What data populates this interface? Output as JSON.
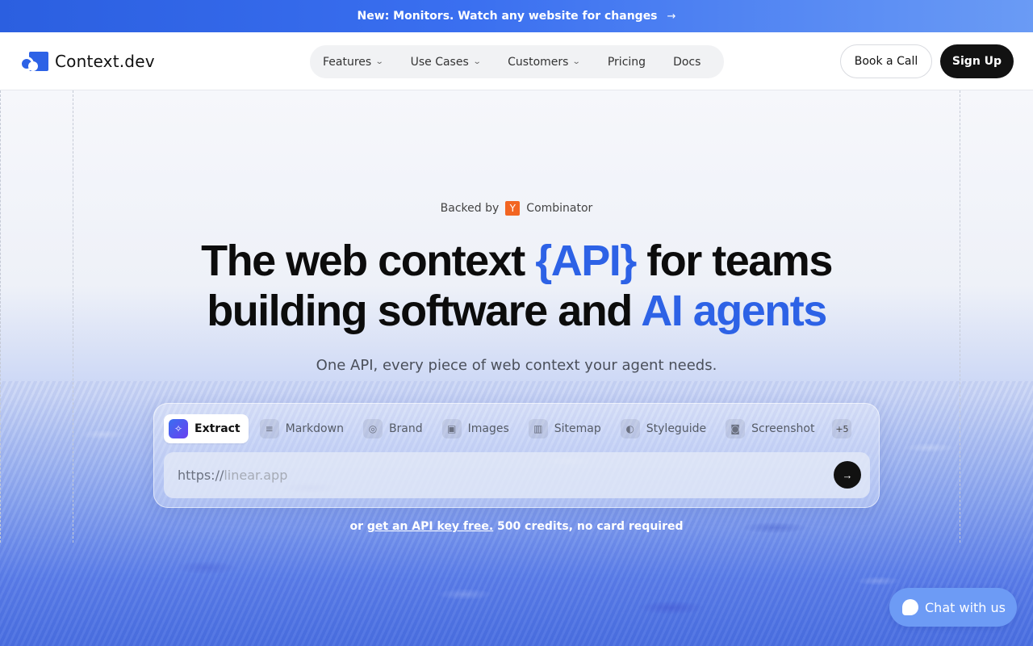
{
  "announcement": {
    "text": "New: Monitors. Watch any website for changes",
    "arrow": "→"
  },
  "header": {
    "logo_text": "Context.dev",
    "nav": [
      {
        "label": "Features",
        "has_menu": true
      },
      {
        "label": "Use Cases",
        "has_menu": true
      },
      {
        "label": "Customers",
        "has_menu": true
      },
      {
        "label": "Pricing",
        "has_menu": false
      },
      {
        "label": "Docs",
        "has_menu": false
      }
    ],
    "chevron": "⌄",
    "book_call": "Book a Call",
    "sign_up": "Sign Up"
  },
  "hero": {
    "backed_prefix": "Backed by",
    "yc_letter": "Y",
    "backed_suffix": "Combinator",
    "headline_part1": "The web context ",
    "headline_accent1": "{API}",
    "headline_part2": " for teams",
    "headline_part3": "building software and ",
    "headline_accent2": "AI agents",
    "subhead": "One API, every piece of web context your agent needs."
  },
  "tool": {
    "tabs": [
      {
        "label": "Extract",
        "icon": "sparkle-icon",
        "glyph": "✧",
        "active": true
      },
      {
        "label": "Markdown",
        "icon": "markdown-icon",
        "glyph": "≡",
        "active": false
      },
      {
        "label": "Brand",
        "icon": "brand-icon",
        "glyph": "◎",
        "active": false
      },
      {
        "label": "Images",
        "icon": "image-icon",
        "glyph": "▣",
        "active": false
      },
      {
        "label": "Sitemap",
        "icon": "map-icon",
        "glyph": "▥",
        "active": false
      },
      {
        "label": "Styleguide",
        "icon": "palette-icon",
        "glyph": "◐",
        "active": false
      },
      {
        "label": "Screenshot",
        "icon": "camera-icon",
        "glyph": "◙",
        "active": false
      }
    ],
    "more_label": "+5",
    "url_prefix": "https://",
    "url_placeholder": "linear.app",
    "go_glyph": "→"
  },
  "footnote": {
    "prefix": "or ",
    "link": "get an API key free.",
    "suffix": " 500 credits, no card required"
  },
  "chat": {
    "label": "Chat with us"
  },
  "colors": {
    "accent": "#2d62e6",
    "yc_orange": "#f26522",
    "dark_button": "#121212"
  }
}
